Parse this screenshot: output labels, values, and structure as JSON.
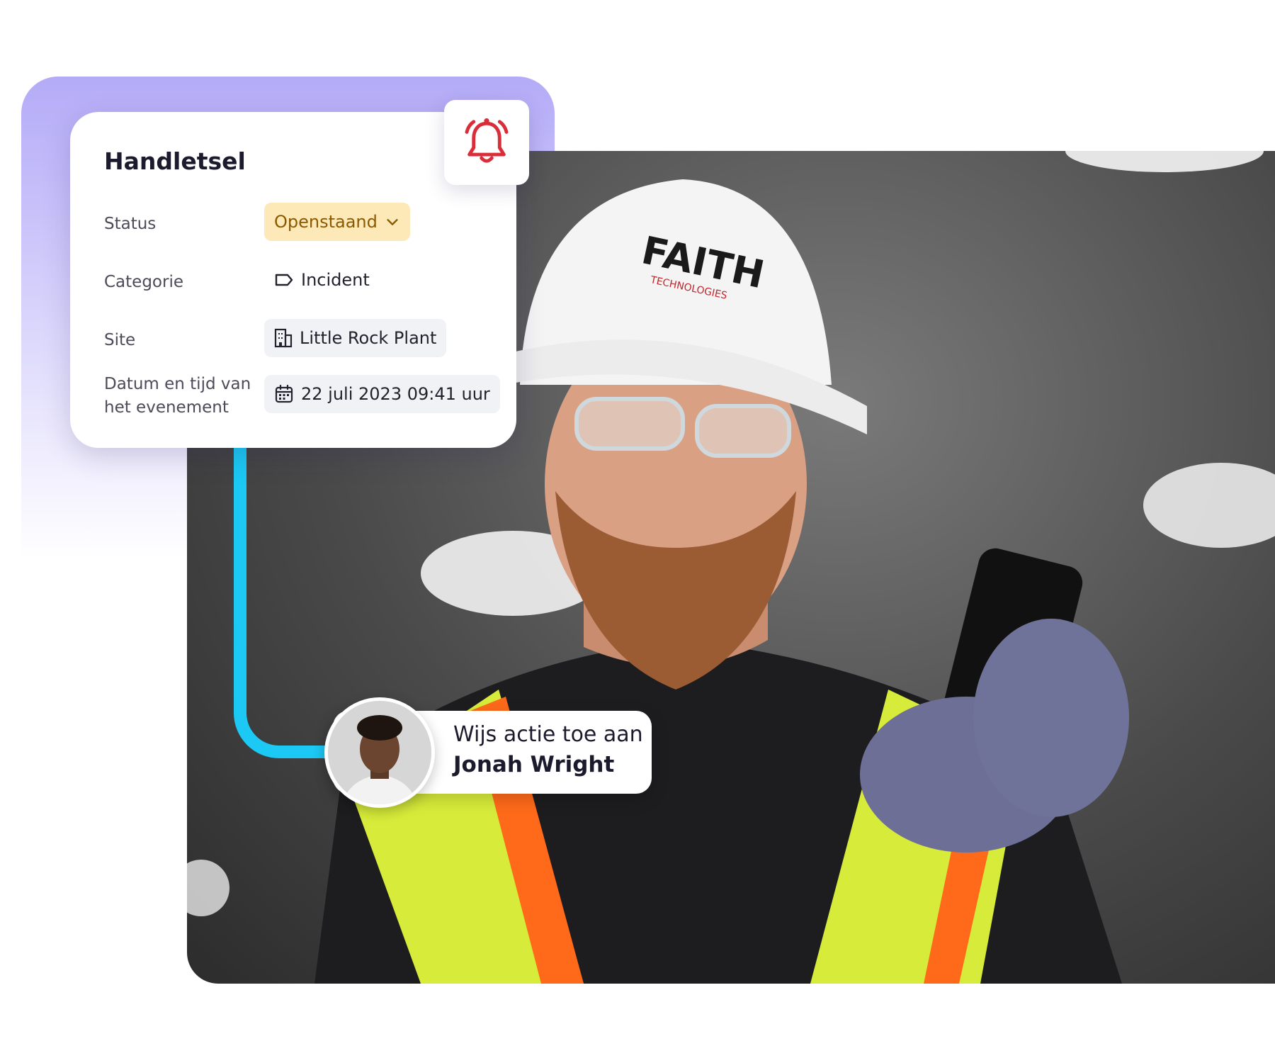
{
  "card": {
    "title": "Handletsel",
    "rows": {
      "status": {
        "label": "Status",
        "value": "Openstaand"
      },
      "category": {
        "label": "Categorie",
        "value": "Incident"
      },
      "site": {
        "label": "Site",
        "value": "Little Rock Plant"
      },
      "datetime": {
        "label_line1": "Datum en tijd van",
        "label_line2": "het evenement",
        "value": "22 juli 2023 09:41 uur"
      }
    }
  },
  "assignment": {
    "line1": "Wijs actie toe aan",
    "assignee": "Jonah Wright"
  },
  "photo": {
    "helmet_logo_text": "FAITH",
    "helmet_logo_subtext": "TECHNOLOGIES"
  },
  "colors": {
    "accent_purple": "#b4abf7",
    "connector_blue": "#1cc8f4",
    "status_bg": "#fde9b8",
    "status_text": "#8a5a00",
    "bell_red": "#d92d3a"
  },
  "icons": {
    "bell": "bell-icon",
    "chevron": "chevron-down-icon",
    "tag": "tag-icon",
    "building": "building-icon",
    "calendar": "calendar-icon"
  }
}
